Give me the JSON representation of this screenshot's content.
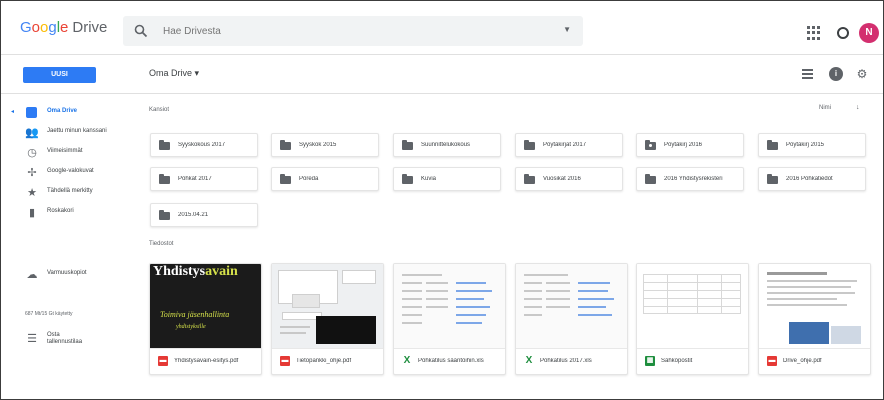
{
  "app": {
    "logo_parts": [
      "G",
      "o",
      "o",
      "g",
      "l",
      "e"
    ],
    "logo_product": "Drive",
    "search_placeholder": "Hae Drivesta",
    "avatar_initial": "N",
    "brand_color": "#2d7bf4"
  },
  "toolbar": {
    "new_label": "UUSI",
    "breadcrumb": "Oma Drive ▾"
  },
  "sidebar": {
    "items": [
      {
        "label": "Oma Drive",
        "icon": "drive-icon",
        "active": true
      },
      {
        "label": "Jaettu minun kanssani",
        "icon": "people-icon",
        "active": false
      },
      {
        "label": "Viimeisimmät",
        "icon": "clock-icon",
        "active": false
      },
      {
        "label": "Google-valokuvat",
        "icon": "pinwheel-icon",
        "active": false
      },
      {
        "label": "Tähdellä merkitty",
        "icon": "star-icon",
        "active": false
      },
      {
        "label": "Roskakori",
        "icon": "trash-icon",
        "active": false
      }
    ],
    "backups": {
      "label": "Varmuuskopiot",
      "icon": "cloud-icon"
    },
    "storage_text": "687 Mt/15 Gt käytetty",
    "buy_storage": {
      "line1": "Osta",
      "line2": "tallennustilaa",
      "icon": "storage-icon"
    }
  },
  "main": {
    "folders_label": "Kansiot",
    "files_label": "Tiedostot",
    "sort_label": "Nimi",
    "sort_arrow": "↓",
    "folders": [
      {
        "name": "Syyskokous 2017",
        "shared": false
      },
      {
        "name": "Syyskok 2015",
        "shared": false
      },
      {
        "name": "Suunnittelukokous",
        "shared": false
      },
      {
        "name": "Pöytäkirjat 2017",
        "shared": false
      },
      {
        "name": "Pöytäkirj 2016",
        "shared": true
      },
      {
        "name": "Pöytäkirj 2015",
        "shared": false
      },
      {
        "name": "Pöhkat 2017",
        "shared": false
      },
      {
        "name": "Pöreda",
        "shared": false
      },
      {
        "name": "Kuvia",
        "shared": false
      },
      {
        "name": "Vuosikat 2016",
        "shared": false
      },
      {
        "name": "2016 Yhdistysrekisteri",
        "shared": false
      },
      {
        "name": "2016 Pöhkatiedot",
        "shared": false
      },
      {
        "name": "2015.04.21",
        "shared": false
      }
    ],
    "files": [
      {
        "name": "Yhdistysavain-esitys.pdf",
        "type": "pdf",
        "type_icon": "pdf-icon"
      },
      {
        "name": "Tietopankki_ohje.pdf",
        "type": "pdf",
        "type_icon": "pdf-icon"
      },
      {
        "name": "Pöhkatilus sääntöihin.xls",
        "type": "xls",
        "type_icon": "excel-icon"
      },
      {
        "name": "Pöhkatilus 2017.xls",
        "type": "xls",
        "type_icon": "excel-icon"
      },
      {
        "name": "Sähköpostit",
        "type": "sheet",
        "type_icon": "sheets-icon"
      },
      {
        "name": "Drive_ohje.pdf",
        "type": "pdf",
        "type_icon": "pdf-icon"
      }
    ],
    "poster": {
      "title_white": "Yhdistys",
      "title_yellow": "avain",
      "subtitle": "Toimiva jäsenhallinta",
      "subtitle2": "yhdistyksille"
    }
  }
}
